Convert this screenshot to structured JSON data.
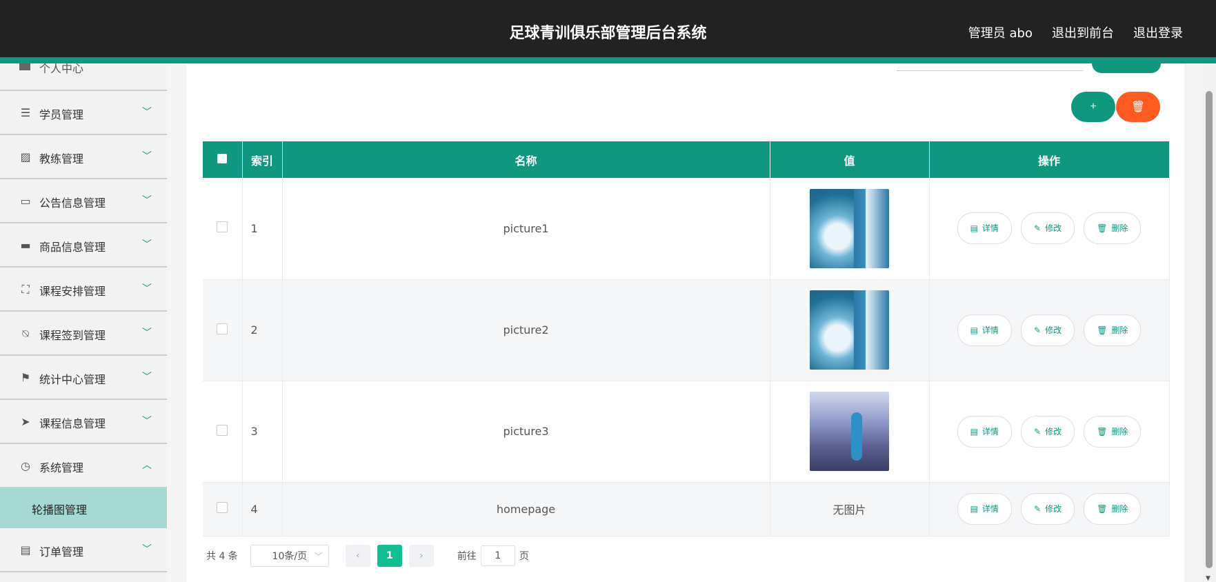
{
  "header": {
    "title": "足球青训俱乐部管理后台系统",
    "admin": "管理员 abo",
    "back_to_front": "退出到前台",
    "logout": "退出登录"
  },
  "sidebar": {
    "partial_item": "个人中心",
    "items": [
      {
        "label": "学员管理",
        "icon": "list-icon",
        "glyph": "☰"
      },
      {
        "label": "教练管理",
        "icon": "chart-icon",
        "glyph": "▨"
      },
      {
        "label": "公告信息管理",
        "icon": "monitor-icon",
        "glyph": "▭"
      },
      {
        "label": "商品信息管理",
        "icon": "ticket-icon",
        "glyph": "▬"
      },
      {
        "label": "课程安排管理",
        "icon": "fullscreen-icon",
        "glyph": "⛶"
      },
      {
        "label": "课程签到管理",
        "icon": "bell-off-icon",
        "glyph": "⍉"
      },
      {
        "label": "统计中心管理",
        "icon": "flag-icon",
        "glyph": "⚑"
      },
      {
        "label": "课程信息管理",
        "icon": "send-icon",
        "glyph": "➤"
      },
      {
        "label": "系统管理",
        "icon": "clock-icon",
        "glyph": "◷",
        "expanded": true
      }
    ],
    "sub_item": "轮播图管理",
    "last_item": {
      "label": "订单管理",
      "icon": "wallet-icon",
      "glyph": "▤"
    },
    "chevron_down": "﹀",
    "chevron_up": "︿"
  },
  "toolbar": {
    "add_label": "+",
    "delete_label": "🗑"
  },
  "table": {
    "headers": {
      "index": "索引",
      "name": "名称",
      "value": "值",
      "actions": "操作"
    },
    "rows": [
      {
        "index": "1",
        "name": "picture1",
        "image": "ocean"
      },
      {
        "index": "2",
        "name": "picture2",
        "image": "ocean"
      },
      {
        "index": "3",
        "name": "picture3",
        "image": "poster"
      },
      {
        "index": "4",
        "name": "homepage",
        "no_image": "无图片"
      }
    ],
    "actions": {
      "detail": "详情",
      "edit": "修改",
      "delete": "删除"
    }
  },
  "pagination": {
    "total": "共 4 条",
    "page_size": "10条/页",
    "current_page": "1",
    "goto_label": "前往",
    "goto_value": "1",
    "page_suffix": "页"
  },
  "colors": {
    "primary": "#10977f",
    "danger": "#ff5a1f",
    "header_bg": "#222222",
    "active_sub": "#a6d9d3"
  }
}
